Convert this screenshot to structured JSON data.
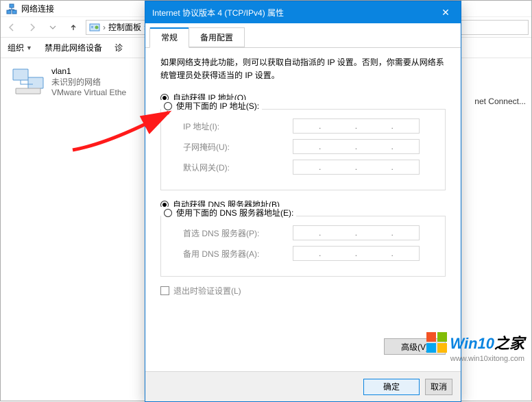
{
  "explorer": {
    "title": "网络连接",
    "breadcrumb": {
      "root": "控制面板"
    },
    "toolbar": {
      "organize": "组织",
      "disable": "禁用此网络设备",
      "diagnose": "诊"
    },
    "device": {
      "name": "vlan1",
      "status": "未识别的网络",
      "adapter": "VMware Virtual Ethe"
    },
    "side_cut": "net Connect..."
  },
  "dialog": {
    "title": "Internet 协议版本 4 (TCP/IPv4) 属性",
    "close": "✕",
    "tabs": {
      "general": "常规",
      "alternate": "备用配置"
    },
    "intro": "如果网络支持此功能，则可以获取自动指派的 IP 设置。否则，你需要从网络系统管理员处获得适当的 IP 设置。",
    "ip": {
      "auto": "自动获得 IP 地址(O)",
      "manual": "使用下面的 IP 地址(S):",
      "addr": "IP 地址(I):",
      "mask": "子网掩码(U):",
      "gateway": "默认网关(D):"
    },
    "dns": {
      "auto": "自动获得 DNS 服务器地址(B)",
      "manual": "使用下面的 DNS 服务器地址(E):",
      "pref": "首选 DNS 服务器(P):",
      "alt": "备用 DNS 服务器(A):"
    },
    "validate": "退出时验证设置(L)",
    "advanced": "高级(V)",
    "ok": "确定",
    "cancel": "取消"
  },
  "watermark": {
    "brand1": "Win10",
    "brand2": "之家",
    "url": "www.win10xitong.com"
  }
}
